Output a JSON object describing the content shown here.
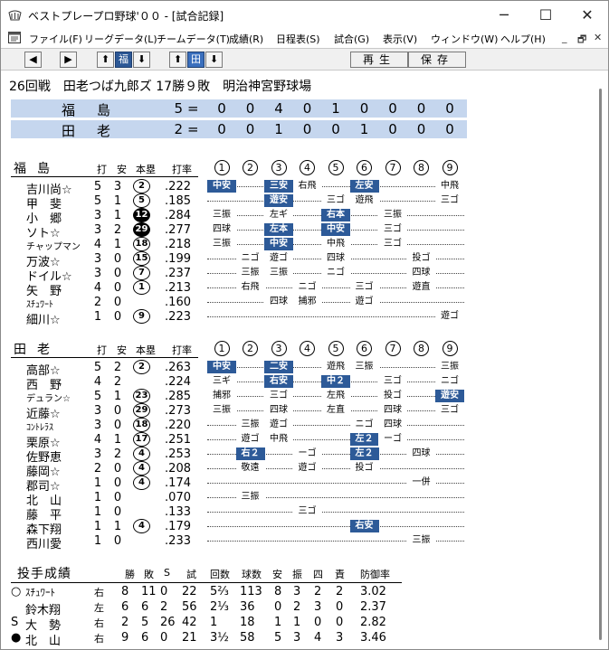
{
  "window": {
    "title": "ベストプレープロ野球'００ - [試合記録]",
    "btn_min": "─",
    "btn_max": "☐",
    "btn_close": "✕"
  },
  "menu": {
    "items": [
      "ファイル(F)",
      "リーグデータ(L)",
      "チームデータ(T)",
      "成績(R)",
      "日程表(S)",
      "試合(G)",
      "表示(V)",
      "ウィンドウ(W)",
      "ヘルプ(H)"
    ],
    "mdi": [
      "_",
      "🗗",
      "✕"
    ]
  },
  "toolbar": {
    "prev": "◀",
    "next": "▶",
    "up_left": "⬆",
    "team_left": "福",
    "down_left": "⬇",
    "up_right": "⬆",
    "team_right": "田",
    "down_right": "⬇",
    "play_label": "再生",
    "save_label": "保存"
  },
  "game_info": "26回戦　田老つば九郎ズ 17勝９敗　明治神宮野球場",
  "linescore": [
    {
      "team": "福島",
      "runs": "5",
      "eq": "=",
      "innings": [
        "0",
        "0",
        "4",
        "0",
        "1",
        "0",
        "0",
        "0",
        "0"
      ]
    },
    {
      "team": "田老",
      "runs": "2",
      "eq": "=",
      "innings": [
        "0",
        "0",
        "1",
        "0",
        "0",
        "1",
        "0",
        "0",
        "0"
      ]
    }
  ],
  "headers": {
    "ab": "打",
    "h": "安",
    "hr": "本塁",
    "avg": "打率",
    "innings": [
      "1",
      "2",
      "3",
      "4",
      "5",
      "6",
      "7",
      "8",
      "9"
    ]
  },
  "team1": {
    "name": "福島",
    "players": [
      {
        "name": "吉川尚☆",
        "ab": "5",
        "h": "3",
        "hr": "2",
        "cur": false,
        "avg": ".222",
        "res": [
          [
            "中安",
            1,
            true
          ],
          [
            "三安",
            3,
            true
          ],
          [
            "右飛",
            4,
            false
          ],
          [
            "左安",
            6,
            true
          ],
          [
            "中飛",
            9,
            false
          ]
        ]
      },
      {
        "name": "甲　斐",
        "ab": "5",
        "h": "1",
        "hr": "5",
        "cur": false,
        "avg": ".185",
        "res": [
          [
            "遊安",
            3,
            true
          ],
          [
            "三ゴ",
            5,
            false
          ],
          [
            "遊飛",
            6,
            false
          ],
          [
            "三ゴ",
            9,
            false
          ]
        ]
      },
      {
        "name": "小　郷",
        "ab": "3",
        "h": "1",
        "hr": "12",
        "cur": true,
        "avg": ".284",
        "res": [
          [
            "三振",
            1,
            false
          ],
          [
            "左ギ",
            3,
            false
          ],
          [
            "右本",
            5,
            true
          ],
          [
            "三振",
            7,
            false
          ]
        ]
      },
      {
        "name": "ソト☆",
        "ab": "3",
        "h": "2",
        "hr": "29",
        "cur": true,
        "avg": ".277",
        "res": [
          [
            "四球",
            1,
            false
          ],
          [
            "左本",
            3,
            true
          ],
          [
            "中安",
            5,
            true
          ],
          [
            "三ゴ",
            7,
            false
          ]
        ]
      },
      {
        "name": "チャップマン",
        "ab": "4",
        "h": "1",
        "hr": "18",
        "cur": false,
        "avg": ".218",
        "small": true,
        "res": [
          [
            "三振",
            1,
            false
          ],
          [
            "中安",
            3,
            true
          ],
          [
            "中飛",
            5,
            false
          ],
          [
            "三ゴ",
            7,
            false
          ]
        ]
      },
      {
        "name": "万波☆",
        "ab": "3",
        "h": "0",
        "hr": "15",
        "cur": false,
        "avg": ".199",
        "res": [
          [
            "ニゴ",
            2,
            false
          ],
          [
            "遊ゴ",
            3,
            false
          ],
          [
            "四球",
            5,
            false
          ],
          [
            "投ゴ",
            8,
            false
          ]
        ]
      },
      {
        "name": "ドイル☆",
        "ab": "3",
        "h": "0",
        "hr": "7",
        "cur": false,
        "avg": ".237",
        "res": [
          [
            "三振",
            2,
            false
          ],
          [
            "三振",
            3,
            false
          ],
          [
            "ニゴ",
            5,
            false
          ],
          [
            "四球",
            8,
            false
          ]
        ]
      },
      {
        "name": "矢　野",
        "ab": "4",
        "h": "0",
        "hr": "1",
        "cur": false,
        "avg": ".213",
        "res": [
          [
            "右飛",
            2,
            false
          ],
          [
            "ニゴ",
            4,
            false
          ],
          [
            "三ゴ",
            6,
            false
          ],
          [
            "遊直",
            8,
            false
          ]
        ]
      },
      {
        "name": "ｽﾁｭﾜｰﾄ",
        "ab": "2",
        "h": "0",
        "hr": "",
        "cur": false,
        "avg": ".160",
        "small": true,
        "res": [
          [
            "四球",
            3,
            false
          ],
          [
            "捕邪",
            4,
            false
          ],
          [
            "遊ゴ",
            6,
            false
          ]
        ]
      },
      {
        "name": "細川☆",
        "ab": "1",
        "h": "0",
        "hr": "9",
        "cur": false,
        "avg": ".223",
        "res": [
          [
            "遊ゴ",
            9,
            false
          ]
        ]
      }
    ]
  },
  "team2": {
    "name": "田老",
    "players": [
      {
        "name": "高部☆",
        "ab": "5",
        "h": "2",
        "hr": "2",
        "cur": false,
        "avg": ".263",
        "res": [
          [
            "中安",
            1,
            true
          ],
          [
            "二安",
            3,
            true
          ],
          [
            "遊飛",
            5,
            false
          ],
          [
            "三振",
            6,
            false
          ],
          [
            "三振",
            9,
            false
          ]
        ]
      },
      {
        "name": "西　野",
        "ab": "4",
        "h": "2",
        "hr": "",
        "cur": false,
        "avg": ".224",
        "res": [
          [
            "三ギ",
            1,
            false
          ],
          [
            "右安",
            3,
            true
          ],
          [
            "中２",
            5,
            true
          ],
          [
            "三ゴ",
            7,
            false
          ],
          [
            "ニゴ",
            9,
            false
          ]
        ]
      },
      {
        "name": "デュラン☆",
        "ab": "5",
        "h": "1",
        "hr": "23",
        "cur": false,
        "avg": ".285",
        "small": true,
        "res": [
          [
            "捕邪",
            1,
            false
          ],
          [
            "三ゴ",
            3,
            false
          ],
          [
            "左飛",
            5,
            false
          ],
          [
            "投ゴ",
            7,
            false
          ],
          [
            "遊安",
            9,
            true
          ]
        ]
      },
      {
        "name": "近藤☆",
        "ab": "3",
        "h": "0",
        "hr": "29",
        "cur": false,
        "avg": ".273",
        "res": [
          [
            "三振",
            1,
            false
          ],
          [
            "四球",
            3,
            false
          ],
          [
            "左直",
            5,
            false
          ],
          [
            "四球",
            7,
            false
          ],
          [
            "三ゴ",
            9,
            false
          ]
        ]
      },
      {
        "name": "ｺﾝﾄﾚﾗｽ",
        "ab": "3",
        "h": "0",
        "hr": "18",
        "cur": false,
        "avg": ".220",
        "small": true,
        "res": [
          [
            "三振",
            2,
            false
          ],
          [
            "遊ゴ",
            3,
            false
          ],
          [
            "ニゴ",
            6,
            false
          ],
          [
            "四球",
            7,
            false
          ]
        ]
      },
      {
        "name": "栗原☆",
        "ab": "4",
        "h": "1",
        "hr": "17",
        "cur": false,
        "avg": ".251",
        "res": [
          [
            "遊ゴ",
            2,
            false
          ],
          [
            "中飛",
            3,
            false
          ],
          [
            "左２",
            6,
            true
          ],
          [
            "ーゴ",
            7,
            false
          ]
        ]
      },
      {
        "name": "佐野恵",
        "ab": "3",
        "h": "2",
        "hr": "4",
        "cur": false,
        "avg": ".253",
        "res": [
          [
            "右２",
            2,
            true
          ],
          [
            "ーゴ",
            4,
            false
          ],
          [
            "左２",
            6,
            true
          ],
          [
            "四球",
            8,
            false
          ]
        ]
      },
      {
        "name": "藤岡☆",
        "ab": "2",
        "h": "0",
        "hr": "4",
        "cur": false,
        "avg": ".208",
        "res": [
          [
            "敬遠",
            2,
            false
          ],
          [
            "遊ゴ",
            4,
            false
          ],
          [
            "投ゴ",
            6,
            false
          ]
        ]
      },
      {
        "name": "郡司☆",
        "ab": "1",
        "h": "0",
        "hr": "4",
        "cur": false,
        "avg": ".174",
        "res": [
          [
            "一併",
            8,
            false
          ]
        ]
      },
      {
        "name": "北　山",
        "ab": "1",
        "h": "0",
        "hr": "",
        "cur": false,
        "avg": ".070",
        "res": [
          [
            "三振",
            2,
            false
          ]
        ]
      },
      {
        "name": "藤　平",
        "ab": "1",
        "h": "0",
        "hr": "",
        "cur": false,
        "avg": ".133",
        "res": [
          [
            "三ゴ",
            4,
            false
          ]
        ]
      },
      {
        "name": "森下翔",
        "ab": "1",
        "h": "1",
        "hr": "4",
        "cur": false,
        "avg": ".179",
        "res": [
          [
            "右安",
            6,
            true
          ]
        ]
      },
      {
        "name": "西川愛",
        "ab": "1",
        "h": "0",
        "hr": "",
        "cur": false,
        "avg": ".233",
        "res": [
          [
            "三振",
            8,
            false
          ]
        ]
      }
    ]
  },
  "pitching": {
    "title": "投手成績",
    "headers": [
      "勝",
      "敗",
      "S",
      "試",
      "回数",
      "球数",
      "安",
      "振",
      "四",
      "責",
      "防御率"
    ],
    "rows": [
      {
        "mark": "○",
        "name": "ｽﾁｭﾜｰﾄ",
        "hand": "右",
        "w": "8",
        "l": "11",
        "s": "0",
        "g": "22",
        "ip": "5⅔",
        "np": "113",
        "h": "8",
        "k": "3",
        "bb": "2",
        "er": "2",
        "era": "3.02"
      },
      {
        "mark": "",
        "name": "鈴木翔",
        "hand": "左",
        "w": "6",
        "l": "6",
        "s": "2",
        "g": "56",
        "ip": "2⅓",
        "np": "36",
        "h": "0",
        "k": "2",
        "bb": "3",
        "er": "0",
        "era": "2.37"
      },
      {
        "mark": "S",
        "name": "大　勢",
        "hand": "右",
        "w": "2",
        "l": "5",
        "s": "26",
        "g": "42",
        "ip": "1",
        "np": "18",
        "h": "1",
        "k": "1",
        "bb": "0",
        "er": "0",
        "era": "2.82"
      },
      {
        "mark": "●",
        "name": "北　山",
        "hand": "右",
        "w": "9",
        "l": "6",
        "s": "0",
        "g": "21",
        "ip": "3½",
        "np": "58",
        "h": "5",
        "k": "3",
        "bb": "4",
        "er": "3",
        "era": "3.46"
      }
    ]
  }
}
